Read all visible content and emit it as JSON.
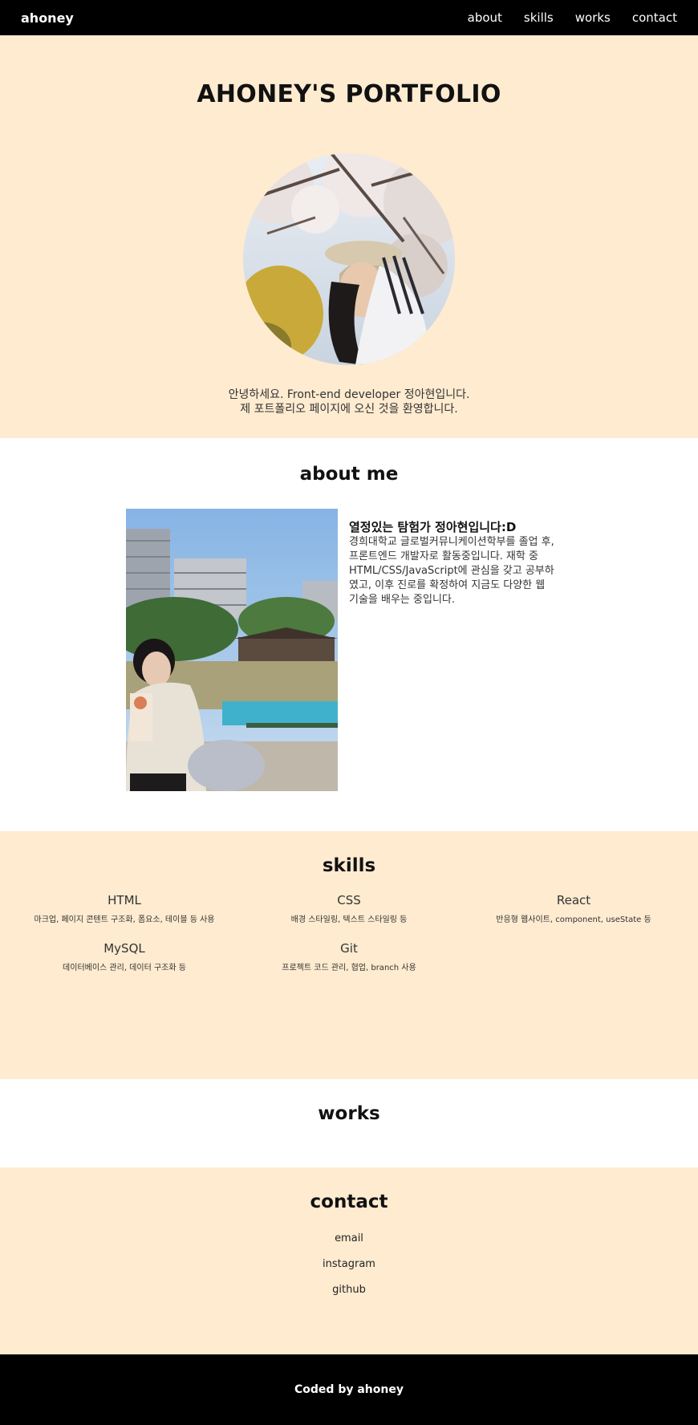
{
  "header": {
    "brand": "ahoney",
    "nav": [
      "about",
      "skills",
      "works",
      "contact"
    ]
  },
  "hero": {
    "title": "AHONEY'S PORTFOLIO",
    "intro_line1": "안녕하세요. Front-end developer 정아현입니다.",
    "intro_line2": "제 포트폴리오 페이지에 오신 것을 환영합니다."
  },
  "about": {
    "title": "about me",
    "heading": "열정있는 탐험가 정아현입니다:D",
    "description": "경희대학교 글로벌커뮤니케이션학부를 졸업 후, 프론트엔드 개발자로 활동중입니다. 재학 중 HTML/CSS/JavaScript에 관심을 갖고 공부하였고, 이후 진로를 확정하여 지금도 다양한 웹 기술을 배우는 중입니다."
  },
  "skills": {
    "title": "skills",
    "items": [
      {
        "name": "HTML",
        "desc": "마크업, 페이지 콘텐트 구조화, 폼요소, 테이블 등 사용"
      },
      {
        "name": "CSS",
        "desc": "배경 스타일링, 텍스트 스타일링 등"
      },
      {
        "name": "React",
        "desc": "반응형 웹사이트, component, useState 등"
      },
      {
        "name": "MySQL",
        "desc": "데이터베이스 관리, 데이터 구조화 등"
      },
      {
        "name": "Git",
        "desc": "프로젝트 코드 관리, 협업, branch 사용"
      }
    ]
  },
  "works": {
    "title": "works"
  },
  "contact": {
    "title": "contact",
    "links": [
      "email",
      "instagram",
      "github"
    ]
  },
  "footer": {
    "text": "Coded by ahoney"
  },
  "colors": {
    "peach": "#feebd0",
    "black": "#000000",
    "white": "#ffffff"
  }
}
